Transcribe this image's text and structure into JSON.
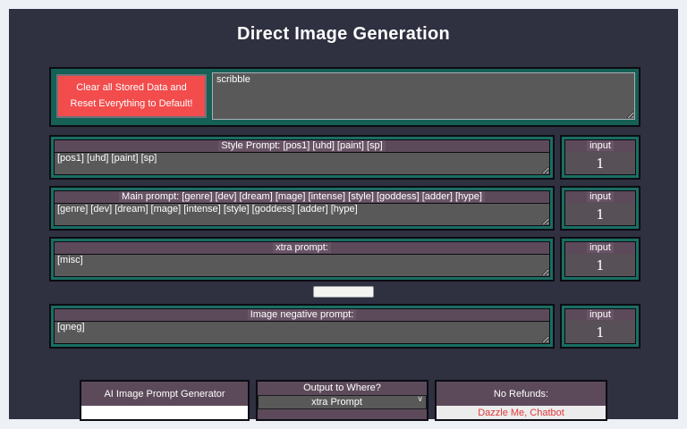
{
  "page": {
    "title": "Direct Image Generation"
  },
  "colors": {
    "page_frame": "#edf0f5",
    "panel_bg": "#2f3040",
    "teal_border": "#1a6e62",
    "teal_bg": "#166055",
    "header_purple": "#5c4a5a",
    "field_gray": "#595959",
    "reset_button_red": "#f24c4c",
    "refund_text_red": "#e03a3a",
    "text_white": "#ffffff"
  },
  "reset_section": {
    "clear_button_label": "Clear all Stored Data and Reset Everything to Default!",
    "scratch_value": "scribble"
  },
  "prompt_sections": [
    {
      "header": "Style Prompt: [pos1] [uhd] [paint] [sp]",
      "value": "[pos1] [uhd] [paint] [sp]",
      "input_label": "input",
      "input_value": "1"
    },
    {
      "header": "Main prompt: [genre] [dev] [dream] [mage] [intense] [style] [goddess] [adder] [hype]",
      "value": "[genre] [dev] [dream] [mage] [intense] [style] [goddess] [adder] [hype]",
      "input_label": "input",
      "input_value": "1"
    },
    {
      "header": "xtra prompt:",
      "value": "[misc]",
      "input_label": "input",
      "input_value": "1"
    },
    {
      "header": "Image negative prompt:",
      "value": "[qneg]",
      "input_label": "input",
      "input_value": "1"
    }
  ],
  "middle_button": {
    "label": ""
  },
  "footer": {
    "generator_box": {
      "label": "AI Image Prompt Generator",
      "input_value": ""
    },
    "output_box": {
      "label": "Output to Where?",
      "select_value": "xtra Prompt"
    },
    "refunds_box": {
      "label": "No Refunds:",
      "button_label": "Dazzle Me, Chatbot"
    }
  }
}
